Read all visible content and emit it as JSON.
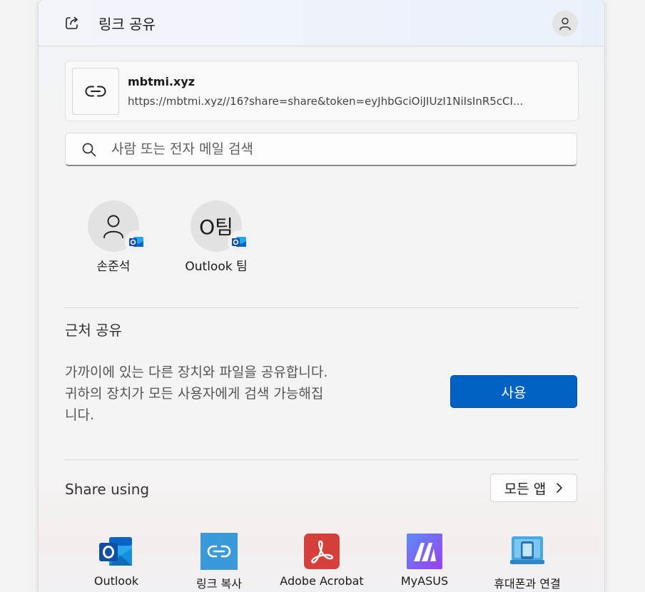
{
  "header": {
    "title": "링크 공유"
  },
  "link": {
    "title": "mbtmi.xyz",
    "url": "https://mbtmi.xyz//16?share=share&token=eyJhbGciOiJIUzI1NiIsInR5cCI..."
  },
  "search": {
    "placeholder": "사람 또는 전자 메일 검색"
  },
  "contacts": [
    {
      "name": "손준석",
      "initials": "",
      "avatar_icon": "person-icon",
      "badge_icon": "outlook-icon"
    },
    {
      "name": "Outlook 팀",
      "initials": "O팀",
      "badge_icon": "outlook-icon"
    }
  ],
  "nearby": {
    "title": "근처 공유",
    "description_lines": [
      "가까이에 있는 다른 장치와 파일을 공유합니다.",
      "귀하의 장치가 모든 사용자에게 검색 가능해집",
      "니다."
    ],
    "button_label": "사용"
  },
  "share_using": {
    "title": "Share using",
    "all_apps_label": "모든 앱",
    "apps": [
      {
        "label": "Outlook",
        "icon": "outlook-icon"
      },
      {
        "label": "링크 복사",
        "icon": "link-copy-icon"
      },
      {
        "label": "Adobe Acrobat",
        "icon": "adobe-acrobat-icon"
      },
      {
        "label": "MyASUS",
        "icon": "myasus-icon"
      },
      {
        "label": "휴대폰과 연결",
        "icon": "phone-link-icon"
      }
    ]
  },
  "colors": {
    "accent": "#0063c4",
    "outlook_blue": "#0a64c8",
    "adobe_red": "#d4403a",
    "link_copy_blue": "#3a9ad9"
  }
}
